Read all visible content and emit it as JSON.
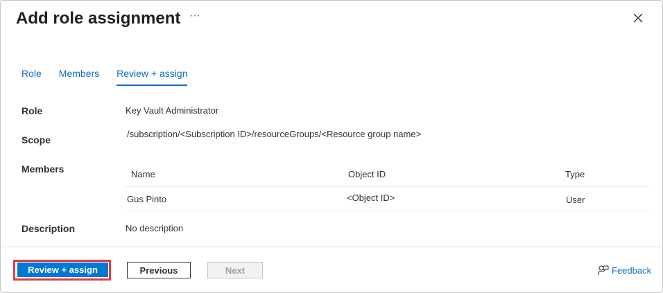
{
  "header": {
    "title": "Add role assignment",
    "more_label": "···"
  },
  "tabs": [
    {
      "label": "Role",
      "active": false
    },
    {
      "label": "Members",
      "active": false
    },
    {
      "label": "Review + assign",
      "active": true
    }
  ],
  "fields": {
    "role_label": "Role",
    "role_value": "Key Vault Administrator",
    "scope_label": "Scope",
    "scope_value": "/subscription/<Subscription ID>/resourceGroups/<Resource group name>",
    "members_label": "Members",
    "description_label": "Description",
    "description_value": "No description"
  },
  "members_table": {
    "columns": [
      "Name",
      "Object ID",
      "Type"
    ],
    "rows": [
      [
        "Gus Pinto",
        "<Object ID>",
        "User"
      ]
    ]
  },
  "footer": {
    "review_assign_label": "Review + assign",
    "previous_label": "Previous",
    "next_label": "Next",
    "feedback_label": "Feedback"
  },
  "colors": {
    "accent": "#0078d4",
    "link": "#0f6cbd",
    "highlight_border": "#e03c45"
  },
  "icons": {
    "more": "ellipsis-icon",
    "close": "close-icon",
    "feedback": "feedback-icon"
  }
}
